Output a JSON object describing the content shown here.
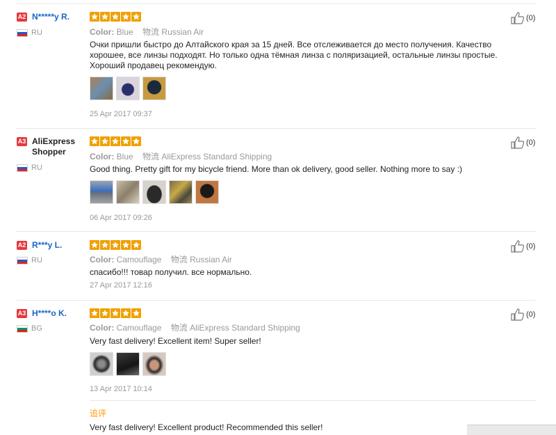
{
  "colors": {
    "star": "#f0a000",
    "link": "#1a66c7",
    "badge": "#e4393c",
    "append": "#f90"
  },
  "reviews": [
    {
      "badge": "A2",
      "name": "N*****y R.",
      "country": "RU",
      "flag": "ru",
      "rating": 5,
      "color_label": "Color:",
      "color_value": "Blue",
      "ship_label": "物流",
      "ship_value": "Russian Air",
      "text": "Очки пришли быстро до Алтайского края за 15 дней. Все отслеживается до место получения. Качество хорошее, все линзы подходят. Но только одна тёмная линза с поляризацией, остальные линзы простые. Хороший продавец рекомендую.",
      "thumbs": [
        "lens-case-photo",
        "sunglasses-pouch-photo",
        "glasses-on-helmet-photo"
      ],
      "date": "25 Apr 2017 09:37",
      "likes": "(0)"
    },
    {
      "badge": "A3",
      "name": "AliExpress Shopper",
      "country": "RU",
      "flag": "ru",
      "rating": 5,
      "color_label": "Color:",
      "color_value": "Blue",
      "ship_label": "物流",
      "ship_value": "AliExpress Standard Shipping",
      "text": "Good thing. Pretty gift for my bicycle friend. More than ok delivery, good seller. Nothing more to say :)",
      "thumbs": [
        "sunglasses-blue-lens-photo",
        "package-photo",
        "glasses-case-photo",
        "lens-set-photo",
        "glasses-on-helmet-photo"
      ],
      "date": "06 Apr 2017 09:26",
      "likes": "(0)"
    },
    {
      "badge": "A2",
      "name": "R***y L.",
      "country": "RU",
      "flag": "ru",
      "rating": 5,
      "color_label": "Color:",
      "color_value": "Camouflage",
      "ship_label": "物流",
      "ship_value": "Russian Air",
      "text": "спасибо!!! товар получил. все нормально.",
      "thumbs": [],
      "date": "27 Apr 2017 12:16",
      "likes": "(0)"
    },
    {
      "badge": "A3",
      "name": "H****o K.",
      "country": "BG",
      "flag": "bg",
      "rating": 5,
      "color_label": "Color:",
      "color_value": "Camouflage",
      "ship_label": "物流",
      "ship_value": "AliExpress Standard Shipping",
      "text": "Very fast delivery! Excellent item! Super seller!",
      "thumbs": [
        "glasses-closeup-photo",
        "box-photo",
        "selfie-photo"
      ],
      "date": "13 Apr 2017 10:14",
      "likes": "(0)",
      "append_label": "追评",
      "append_text": "Very fast delivery! Excellent product! Recommended this seller!"
    }
  ]
}
